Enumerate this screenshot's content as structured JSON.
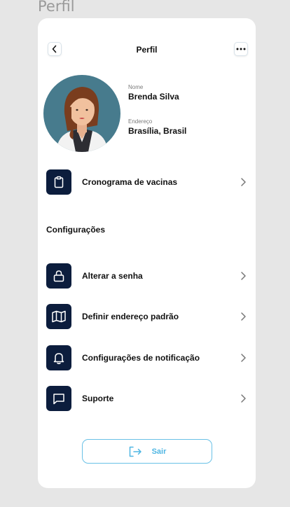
{
  "frame_label": "Perfil",
  "header": {
    "title": "Perfil"
  },
  "profile": {
    "name_label": "Nome",
    "name": "Brenda Silva",
    "address_label": "Endereço",
    "address": "Brasília, Brasil"
  },
  "schedule": {
    "label": "Cronograma de vacinas"
  },
  "settings": {
    "title": "Configurações",
    "items": [
      {
        "label": "Alterar a senha",
        "icon": "lock-icon"
      },
      {
        "label": "Definir endereço padrão",
        "icon": "map-icon"
      },
      {
        "label": "Configurações de notificação",
        "icon": "bell-icon"
      },
      {
        "label": "Suporte",
        "icon": "chat-icon"
      }
    ]
  },
  "logout": {
    "label": "Sair"
  },
  "colors": {
    "icon_bg": "#0c1d3d",
    "accent": "#4fb6e3",
    "avatar_bg": "#477b8d"
  }
}
